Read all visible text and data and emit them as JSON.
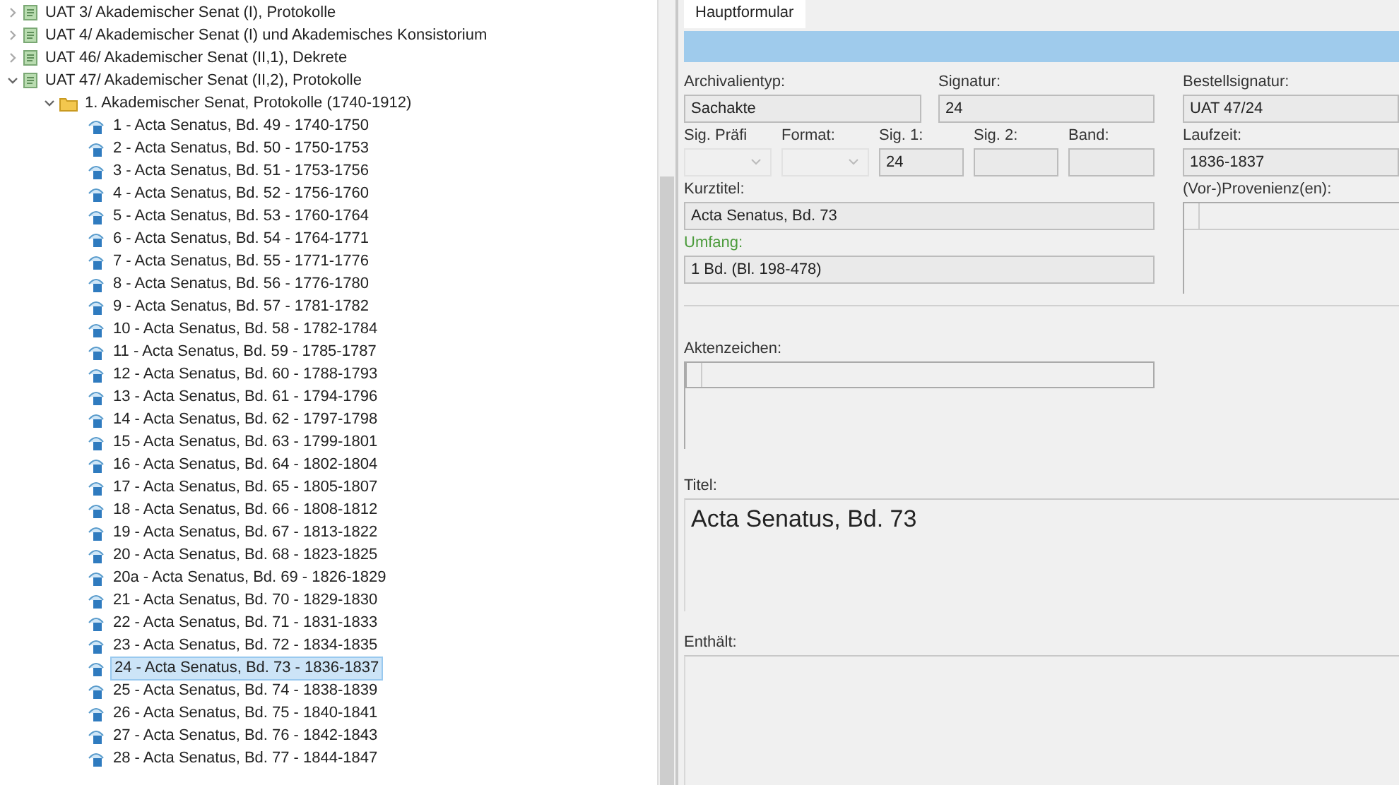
{
  "tree": [
    {
      "label": "UAT 3/ Akademischer Senat (I), Protokolle",
      "kind": "fonds",
      "expanded": false,
      "selected": false
    },
    {
      "label": "UAT 4/ Akademischer Senat (I) und Akademisches Konsistorium",
      "kind": "fonds",
      "expanded": false,
      "selected": false
    },
    {
      "label": "UAT 46/ Akademischer Senat (II,1), Dekrete",
      "kind": "fonds",
      "expanded": false,
      "selected": false
    },
    {
      "label": "UAT 47/ Akademischer Senat (II,2), Protokolle",
      "kind": "fonds",
      "expanded": true,
      "selected": false,
      "children": [
        {
          "label": "1. Akademischer Senat, Protokolle (1740-1912)",
          "kind": "series",
          "expanded": true,
          "selected": false,
          "children": [
            {
              "label": "1 - Acta Senatus, Bd. 49 - 1740-1750",
              "kind": "file",
              "selected": false
            },
            {
              "label": "2 - Acta Senatus, Bd. 50 - 1750-1753",
              "kind": "file",
              "selected": false
            },
            {
              "label": "3 - Acta Senatus, Bd. 51 - 1753-1756",
              "kind": "file",
              "selected": false
            },
            {
              "label": "4 - Acta Senatus, Bd. 52 - 1756-1760",
              "kind": "file",
              "selected": false
            },
            {
              "label": "5 - Acta Senatus, Bd. 53 - 1760-1764",
              "kind": "file",
              "selected": false
            },
            {
              "label": "6 - Acta Senatus, Bd. 54 - 1764-1771",
              "kind": "file",
              "selected": false
            },
            {
              "label": "7 - Acta Senatus, Bd. 55 - 1771-1776",
              "kind": "file",
              "selected": false
            },
            {
              "label": "8 - Acta Senatus, Bd. 56 - 1776-1780",
              "kind": "file",
              "selected": false
            },
            {
              "label": "9 - Acta Senatus, Bd. 57 - 1781-1782",
              "kind": "file",
              "selected": false
            },
            {
              "label": "10 - Acta Senatus, Bd. 58 - 1782-1784",
              "kind": "file",
              "selected": false
            },
            {
              "label": "11 - Acta Senatus, Bd. 59 - 1785-1787",
              "kind": "file",
              "selected": false
            },
            {
              "label": "12 - Acta Senatus, Bd. 60 - 1788-1793",
              "kind": "file",
              "selected": false
            },
            {
              "label": "13 - Acta Senatus, Bd. 61 - 1794-1796",
              "kind": "file",
              "selected": false
            },
            {
              "label": "14 - Acta Senatus, Bd. 62 - 1797-1798",
              "kind": "file",
              "selected": false
            },
            {
              "label": "15 - Acta Senatus, Bd. 63 - 1799-1801",
              "kind": "file",
              "selected": false
            },
            {
              "label": "16 - Acta Senatus, Bd. 64 - 1802-1804",
              "kind": "file",
              "selected": false
            },
            {
              "label": "17 - Acta Senatus, Bd. 65 - 1805-1807",
              "kind": "file",
              "selected": false
            },
            {
              "label": "18 - Acta Senatus, Bd. 66 - 1808-1812",
              "kind": "file",
              "selected": false
            },
            {
              "label": "19 - Acta Senatus, Bd. 67 - 1813-1822",
              "kind": "file",
              "selected": false
            },
            {
              "label": "20 - Acta Senatus, Bd. 68 - 1823-1825",
              "kind": "file",
              "selected": false
            },
            {
              "label": "20a - Acta Senatus, Bd. 69 - 1826-1829",
              "kind": "file",
              "selected": false
            },
            {
              "label": "21 - Acta Senatus, Bd. 70 - 1829-1830",
              "kind": "file",
              "selected": false
            },
            {
              "label": "22 - Acta Senatus, Bd. 71 - 1831-1833",
              "kind": "file",
              "selected": false
            },
            {
              "label": "23 - Acta Senatus, Bd. 72 - 1834-1835",
              "kind": "file",
              "selected": false
            },
            {
              "label": "24 - Acta Senatus, Bd. 73 - 1836-1837",
              "kind": "file",
              "selected": true
            },
            {
              "label": "25 - Acta Senatus, Bd. 74 - 1838-1839",
              "kind": "file",
              "selected": false
            },
            {
              "label": "26 - Acta Senatus, Bd. 75 - 1840-1841",
              "kind": "file",
              "selected": false
            },
            {
              "label": "27 - Acta Senatus, Bd. 76 - 1842-1843",
              "kind": "file",
              "selected": false
            },
            {
              "label": "28 - Acta Senatus, Bd. 77 - 1844-1847",
              "kind": "file",
              "selected": false
            }
          ]
        }
      ]
    }
  ],
  "tabs": [
    {
      "label": "Hauptformular",
      "selected": true
    }
  ],
  "form": {
    "archivalientyp": {
      "label": "Archivalientyp:",
      "value": "Sachakte",
      "highlighted": false
    },
    "signatur": {
      "label": "Signatur:",
      "value": "24",
      "highlighted": false
    },
    "bestellsignatur": {
      "label": "Bestellsignatur:",
      "value": "UAT 47/24",
      "highlighted": false
    },
    "sig_praefix": {
      "label": "Sig. Präfi",
      "highlighted": false
    },
    "format": {
      "label": "Format:",
      "highlighted": false
    },
    "sig1": {
      "label": "Sig. 1:",
      "value": "24",
      "highlighted": false
    },
    "sig2": {
      "label": "Sig. 2:",
      "highlighted": false
    },
    "band": {
      "label": "Band:",
      "highlighted": false
    },
    "laufzeit": {
      "label": "Laufzeit:",
      "value": "1836-1837",
      "highlighted": false
    },
    "kurztitel": {
      "label": "Kurztitel:",
      "value": "Acta Senatus, Bd. 73",
      "highlighted": false
    },
    "provenienz": {
      "label": "(Vor-)Provenienz(en):",
      "highlighted": false
    },
    "umfang": {
      "label": "Umfang:",
      "value": "1 Bd. (Bl. 198-478)",
      "highlighted": true
    },
    "aktenzeichen": {
      "label": "Aktenzeichen:",
      "highlighted": false
    },
    "titel": {
      "label": "Titel:",
      "value": "Acta Senatus, Bd. 73",
      "highlighted": false
    },
    "enthaelt": {
      "label": "Enthält:",
      "highlighted": false
    }
  }
}
